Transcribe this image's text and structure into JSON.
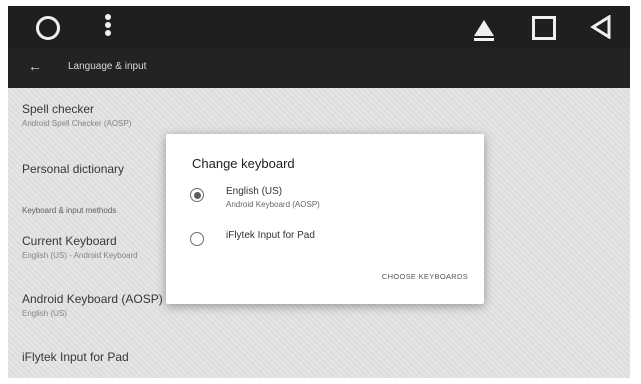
{
  "appbar": {
    "title": "Language & input",
    "back_label": "←"
  },
  "list": {
    "spell_checker": {
      "title": "Spell checker",
      "subtitle": "Android Spell Checker (AOSP)"
    },
    "personal_dictionary": {
      "title": "Personal dictionary"
    },
    "section_keyboard": "Keyboard & input methods",
    "current_keyboard": {
      "title": "Current Keyboard",
      "subtitle": "English (US) - Android Keyboard"
    },
    "android_keyboard": {
      "title": "Android Keyboard (AOSP)",
      "subtitle": "English (US)"
    },
    "iflytek": {
      "title": "iFlytek Input for Pad"
    }
  },
  "dialog": {
    "title": "Change keyboard",
    "options": [
      {
        "label": "English (US)",
        "sublabel": "Android Keyboard (AOSP)",
        "selected": true
      },
      {
        "label": "iFlytek Input for Pad",
        "sublabel": "",
        "selected": false
      }
    ],
    "action": "CHOOSE KEYBOARDS"
  },
  "statusbar_icons": [
    "circle-icon",
    "more-vert-icon",
    "eject-icon",
    "square-icon",
    "back-triangle-icon"
  ]
}
